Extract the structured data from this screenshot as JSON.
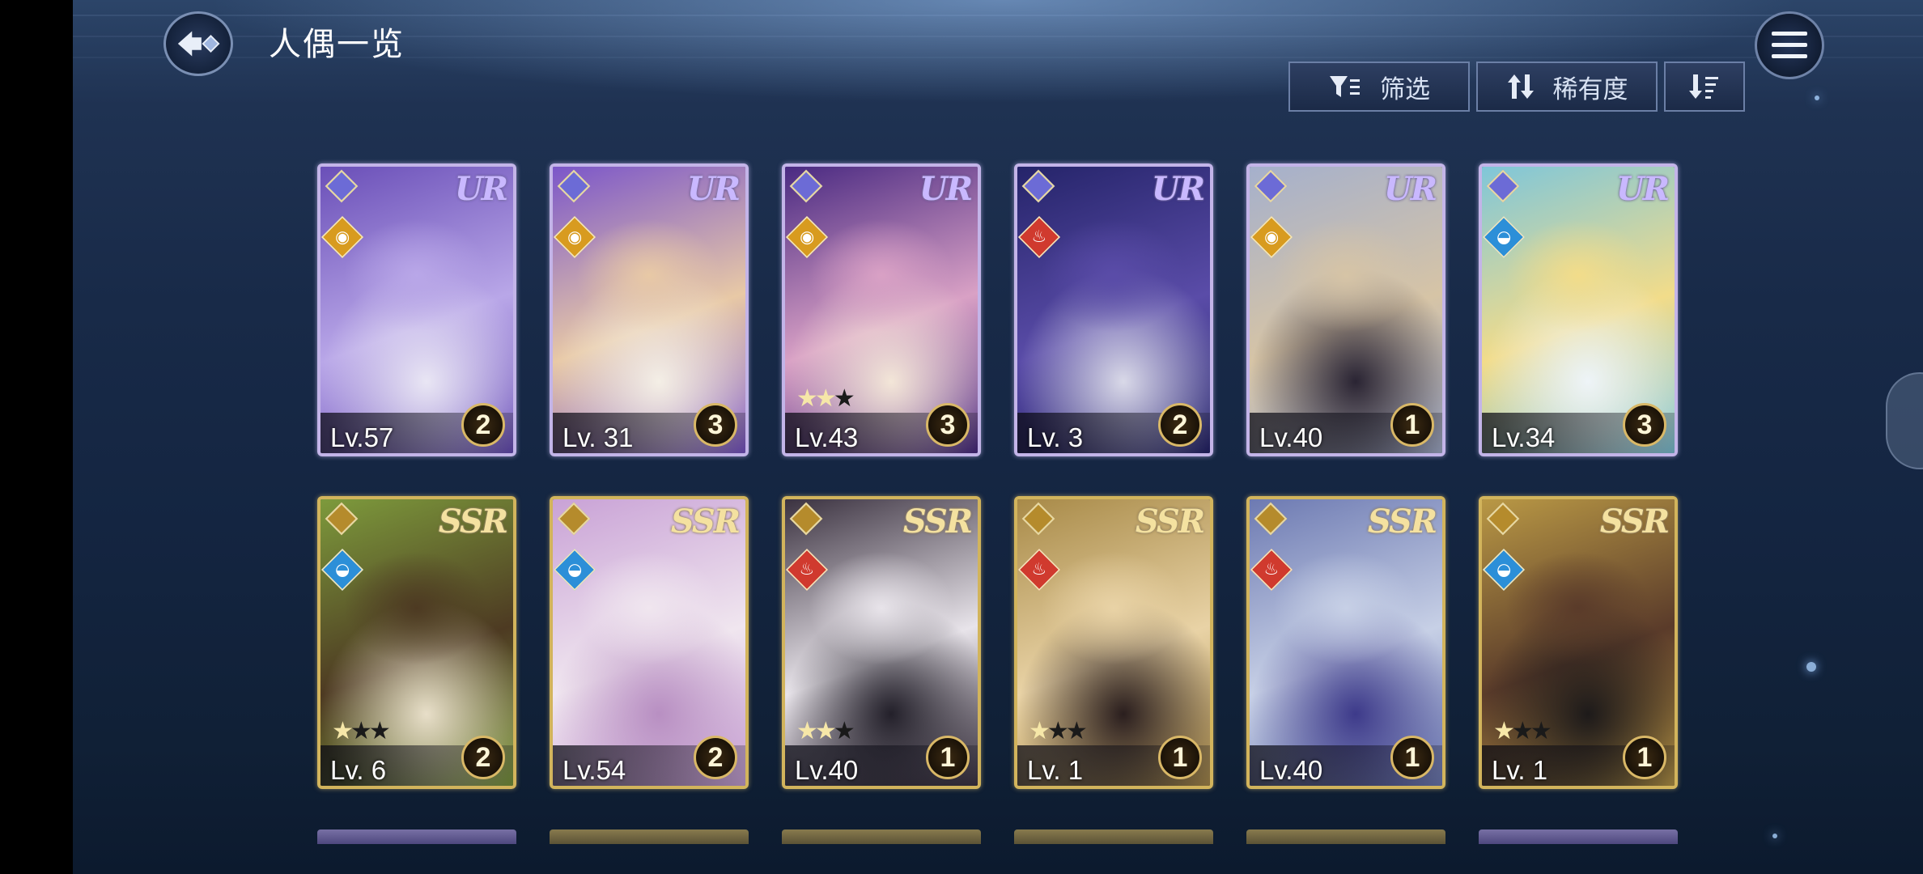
{
  "header": {
    "title": "人偶一览",
    "back_icon": "back-arrow-icon",
    "menu_icon": "hamburger-menu-icon"
  },
  "toolbar": {
    "filter_label": "筛选",
    "filter_icon": "filter-icon",
    "sort_label": "稀有度",
    "sort_icon": "sort-arrows-icon",
    "order_icon": "sort-order-icon"
  },
  "cards": [
    {
      "rarity": "UR",
      "level": "Lv.57",
      "count": "2",
      "element": "light",
      "stars": 0,
      "art": [
        "#6a4fb8",
        "#b9a7e8",
        "#e9e6f4"
      ]
    },
    {
      "rarity": "UR",
      "level": "Lv. 31",
      "count": "3",
      "element": "light",
      "stars": 0,
      "art": [
        "#7b56c9",
        "#e8c9a6",
        "#f4efe6"
      ]
    },
    {
      "rarity": "UR",
      "level": "Lv.43",
      "count": "3",
      "element": "light",
      "stars": 2,
      "art": [
        "#4a2a82",
        "#d9a1c5",
        "#f3e6d8"
      ]
    },
    {
      "rarity": "UR",
      "level": "Lv. 3",
      "count": "2",
      "element": "fire",
      "stars": 0,
      "art": [
        "#25246a",
        "#5a4ca8",
        "#d9d9e8"
      ]
    },
    {
      "rarity": "UR",
      "level": "Lv.40",
      "count": "1",
      "element": "light",
      "stars": 0,
      "art": [
        "#a5b0cc",
        "#d6c4a6",
        "#2a2433"
      ]
    },
    {
      "rarity": "UR",
      "level": "Lv.34",
      "count": "3",
      "element": "water",
      "stars": 0,
      "art": [
        "#7fc6d9",
        "#f2dc8a",
        "#eef4f8"
      ]
    },
    {
      "rarity": "SSR",
      "level": "Lv. 6",
      "count": "2",
      "element": "water",
      "stars": 1,
      "art": [
        "#7d9a3c",
        "#4d3a22",
        "#e8dfc9"
      ]
    },
    {
      "rarity": "SSR",
      "level": "Lv.54",
      "count": "2",
      "element": "water",
      "stars": 0,
      "art": [
        "#c9a2d6",
        "#f0e6ef",
        "#b88fc2"
      ]
    },
    {
      "rarity": "SSR",
      "level": "Lv.40",
      "count": "1",
      "element": "fire",
      "stars": 2,
      "art": [
        "#3b3240",
        "#e8e4ea",
        "#23202a"
      ]
    },
    {
      "rarity": "SSR",
      "level": "Lv. 1",
      "count": "1",
      "element": "fire",
      "stars": 1,
      "art": [
        "#a88a48",
        "#e9d3a6",
        "#2a1e1e"
      ]
    },
    {
      "rarity": "SSR",
      "level": "Lv.40",
      "count": "1",
      "element": "fire",
      "stars": 0,
      "art": [
        "#6d7ab2",
        "#c7d0e6",
        "#3d3a8a"
      ]
    },
    {
      "rarity": "SSR",
      "level": "Lv. 1",
      "count": "1",
      "element": "water",
      "stars": 1,
      "art": [
        "#b99845",
        "#5a3b2a",
        "#1d1a1a"
      ]
    }
  ]
}
